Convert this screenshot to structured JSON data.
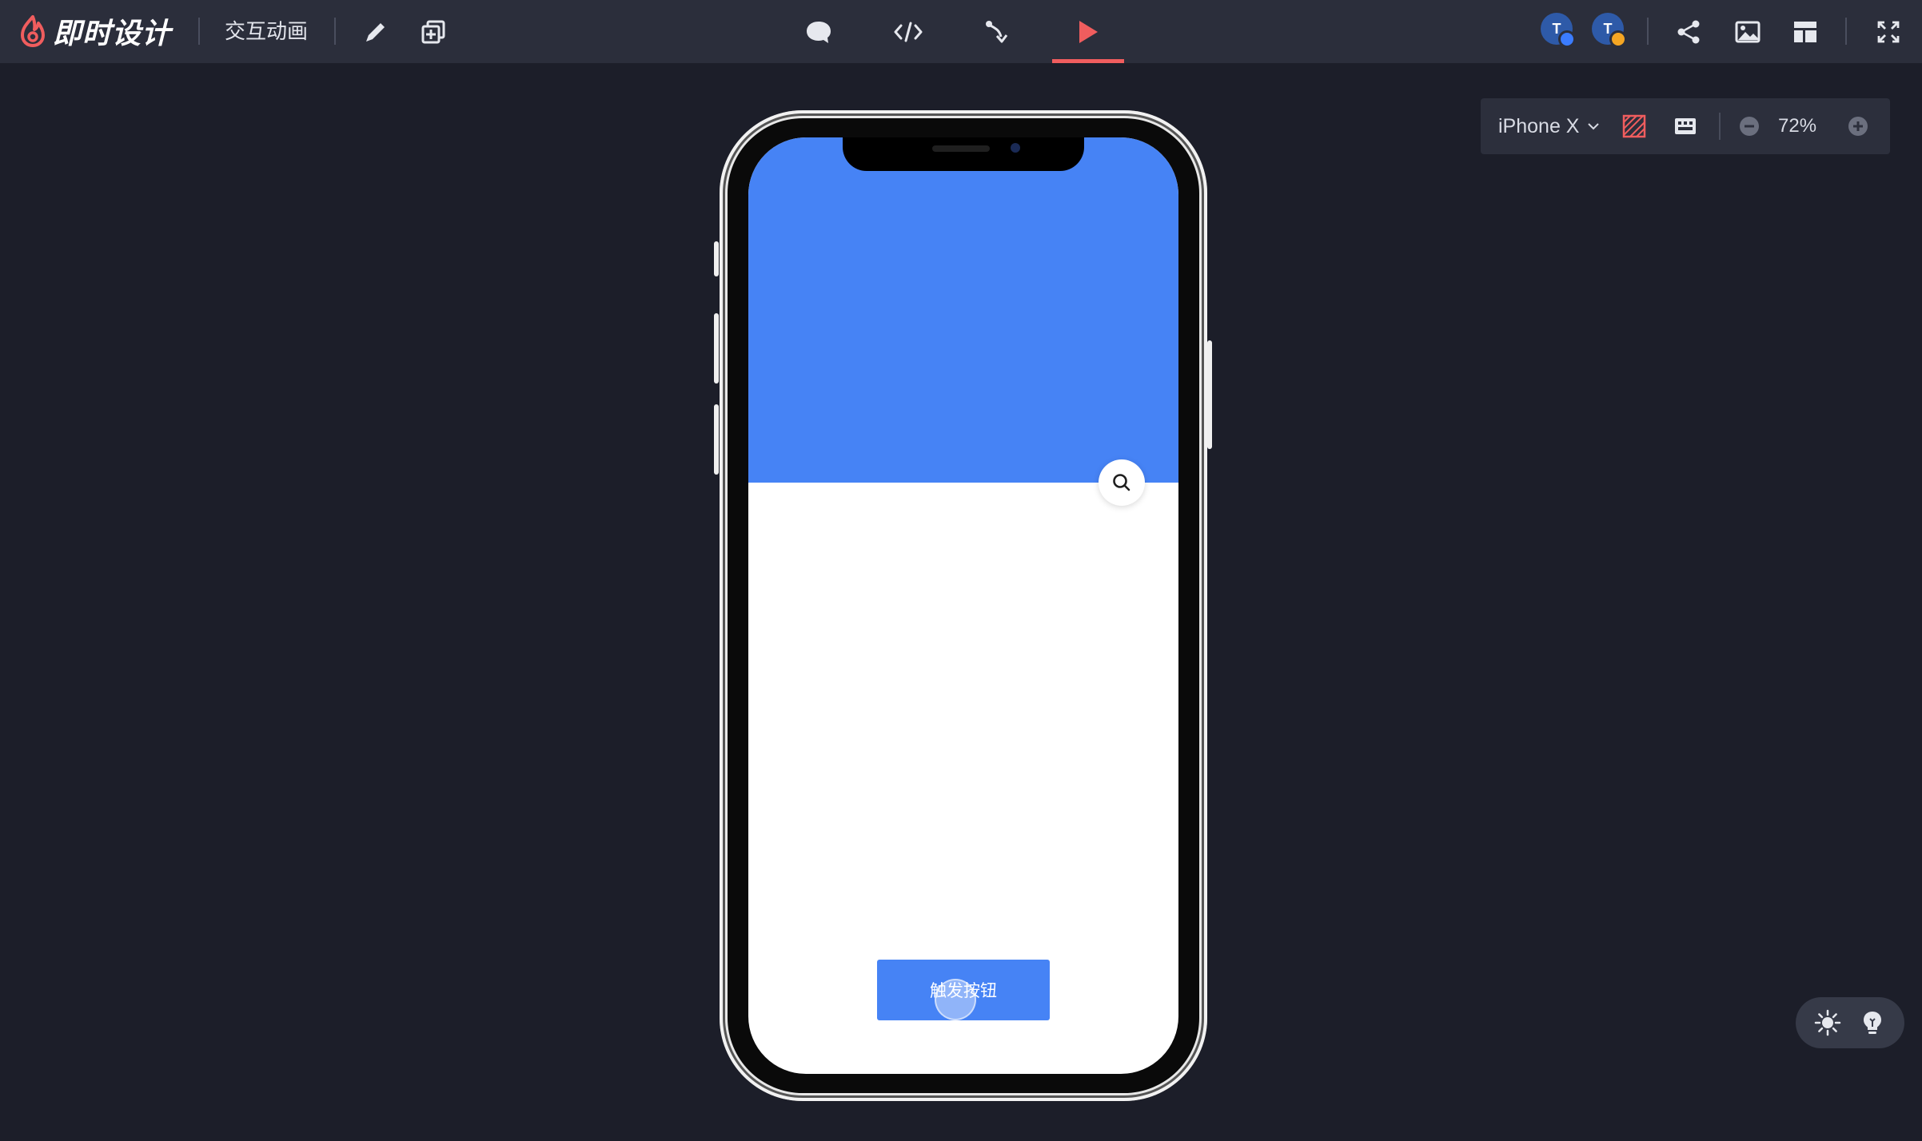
{
  "header": {
    "brand": "即时设计",
    "project_title": "交互动画",
    "tools": [
      {
        "icon": "pencil-icon"
      },
      {
        "icon": "add-frame-icon"
      }
    ],
    "tabs": [
      {
        "icon": "comment-icon"
      },
      {
        "icon": "code-icon"
      },
      {
        "icon": "prototype-link-icon"
      },
      {
        "icon": "play-icon",
        "active": true
      }
    ],
    "avatars": [
      {
        "initial": "T",
        "status_color": "#3b7cff"
      },
      {
        "initial": "T",
        "status_color": "#f5a623"
      }
    ],
    "actions": [
      {
        "icon": "share-icon"
      },
      {
        "icon": "image-icon"
      },
      {
        "icon": "layout-icon"
      },
      {
        "icon": "fullscreen-icon"
      }
    ]
  },
  "device_toolbar": {
    "device": "iPhone X",
    "zoom": "72%"
  },
  "prototype": {
    "trigger_button_label": "触发按钮",
    "hero_color": "#4683f5"
  },
  "colors": {
    "accent": "#f05d5e",
    "primary": "#4683f5",
    "background": "#1c1e29",
    "topbar": "#2b2e3b"
  }
}
